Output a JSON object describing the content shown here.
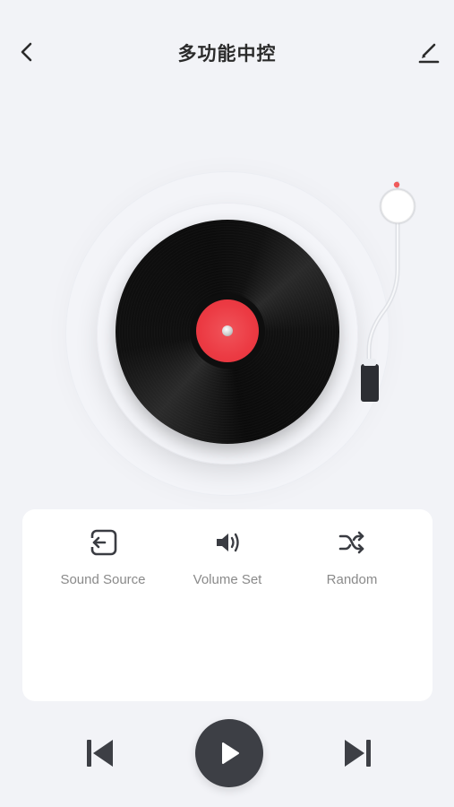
{
  "header": {
    "title": "多功能中控",
    "back_icon": "chevron-left-icon",
    "edit_icon": "pencil-icon"
  },
  "player": {
    "record_label_color": "#ec3a43",
    "tonearm_tip_color": "#f05a5a"
  },
  "panel": {
    "items": [
      {
        "label": "Sound Source",
        "icon": "input-source-icon"
      },
      {
        "label": "Volume Set",
        "icon": "volume-icon"
      },
      {
        "label": "Random",
        "icon": "shuffle-icon"
      }
    ]
  },
  "controls": {
    "previous_icon": "skip-previous-icon",
    "play_icon": "play-icon",
    "next_icon": "skip-next-icon",
    "play_button_color": "#3d3f45"
  }
}
